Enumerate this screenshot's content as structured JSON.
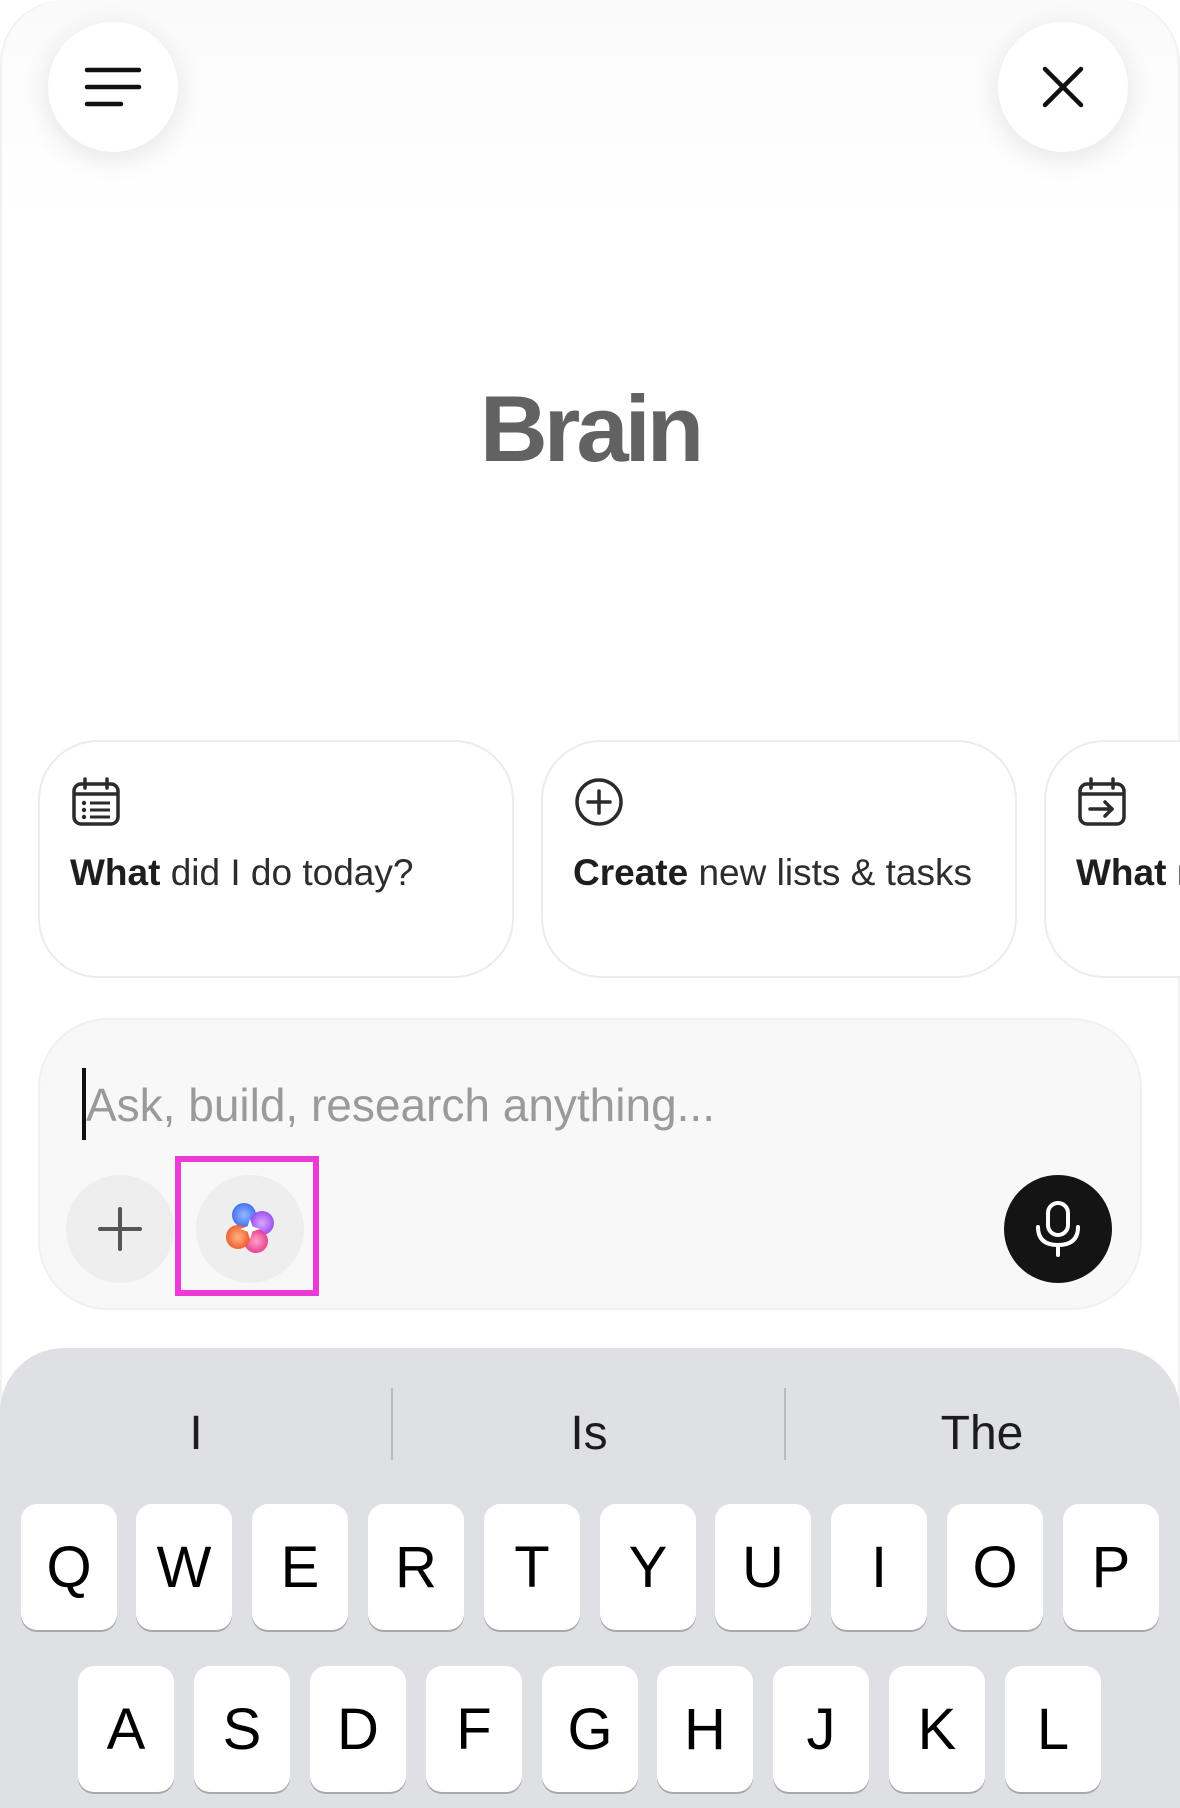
{
  "header": {
    "menu_icon": "menu-icon",
    "close_icon": "close-icon"
  },
  "logo": "Brain",
  "suggestions": [
    {
      "icon": "calendar-list-icon",
      "bold": "What",
      "text": " did I do today?"
    },
    {
      "icon": "plus-circle-icon",
      "bold": "Create",
      "text": " new lists & tasks"
    },
    {
      "icon": "calendar-arrow-icon",
      "bold": "What",
      "text": " next?"
    }
  ],
  "composer": {
    "placeholder": "Ask, build, research anything...",
    "value": "",
    "plus_icon": "plus-icon",
    "ai_icon": "ai-sparkle-icon",
    "mic_icon": "microphone-icon"
  },
  "keyboard": {
    "predictions": [
      "I",
      "Is",
      "The"
    ],
    "row1": [
      "Q",
      "W",
      "E",
      "R",
      "T",
      "Y",
      "U",
      "I",
      "O",
      "P"
    ],
    "row2": [
      "A",
      "S",
      "D",
      "F",
      "G",
      "H",
      "J",
      "K",
      "L"
    ]
  },
  "colors": {
    "highlight": "#ec3ad6",
    "mic_bg": "#141414",
    "keyboard_bg": "#dfe0e4"
  }
}
